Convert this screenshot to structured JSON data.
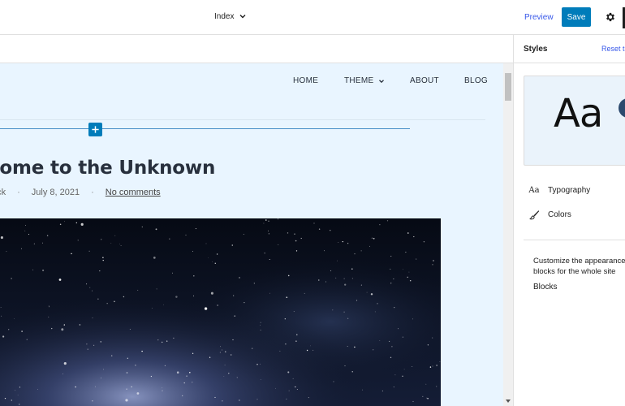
{
  "header": {
    "document_title": "Index",
    "preview_label": "Preview",
    "save_label": "Save",
    "settings_icon": "gear-icon",
    "title_dropdown_icon": "chevron-down-icon"
  },
  "nav": {
    "items": [
      {
        "label": "HOME"
      },
      {
        "label": "THEME",
        "has_submenu": true
      },
      {
        "label": "ABOUT"
      },
      {
        "label": "BLOG"
      }
    ]
  },
  "post": {
    "title": "come to the Unknown",
    "author": "ock",
    "separator": "·",
    "date": "July 8, 2021",
    "comments": "No comments"
  },
  "sidebar": {
    "title": "Styles",
    "reset_label": "Reset to",
    "preview_text": "Aa",
    "menu": [
      {
        "icon": "typography-icon",
        "icon_glyph": "Aa",
        "label": "Typography"
      },
      {
        "icon": "brush-icon",
        "label": "Colors"
      }
    ],
    "description": "Customize the appearance of blocks for the whole site",
    "blocks_label": "Blocks"
  },
  "colors": {
    "accent": "#007cba",
    "link": "#3858e9",
    "canvas_bg": "#e9f5ff",
    "preview_dot": "#2c4a6e"
  }
}
